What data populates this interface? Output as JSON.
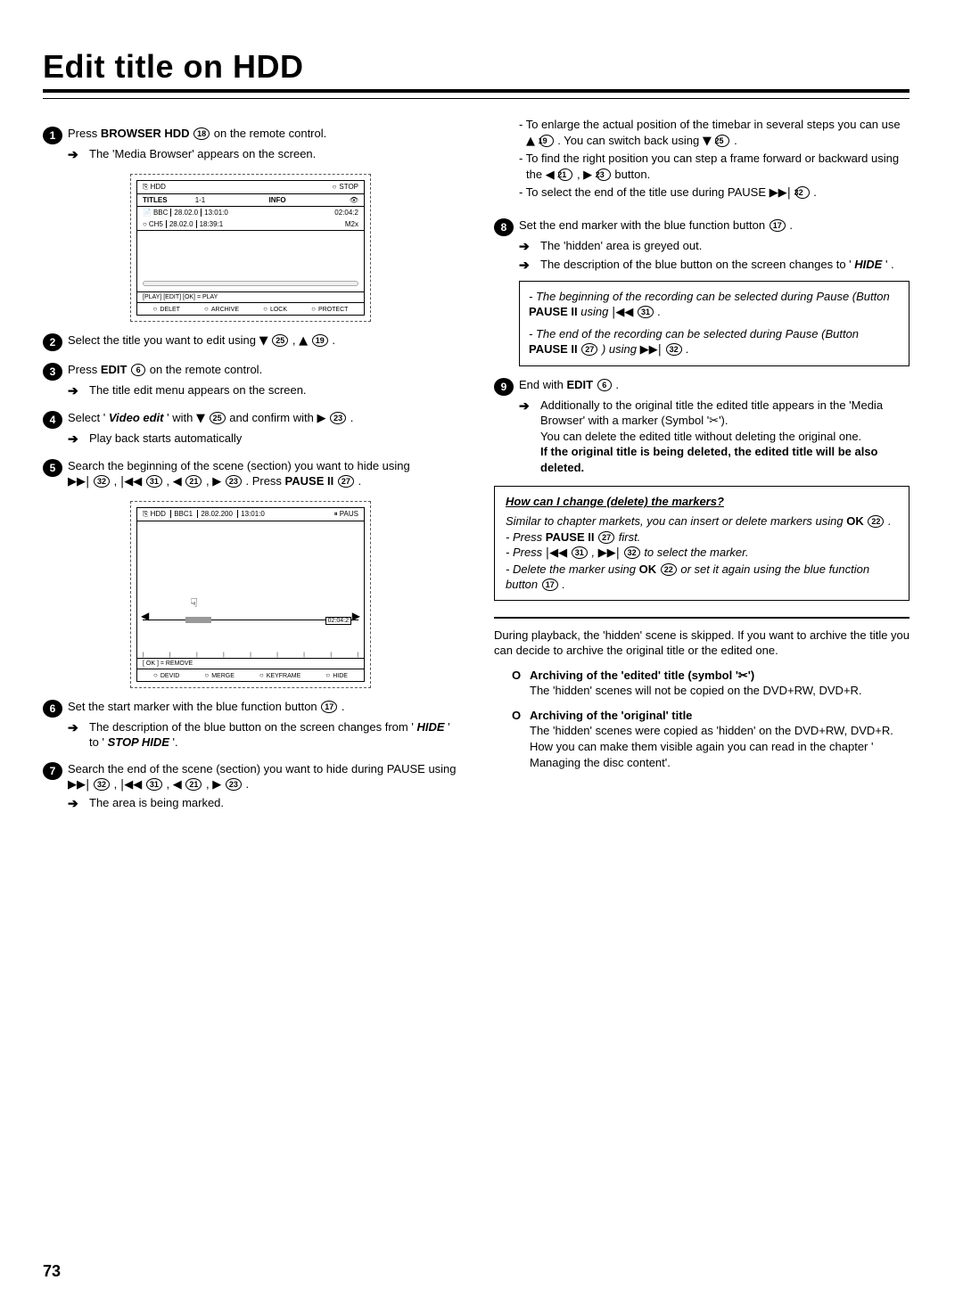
{
  "page_number": "73",
  "heading": "Edit title on HDD",
  "left": {
    "s1": {
      "pre": "Press ",
      "btn": "BROWSER HDD",
      "ref": "18",
      "post": " on the remote control."
    },
    "s1a": "The 'Media Browser' appears on the screen.",
    "screen1": {
      "topLeft": "HDD",
      "topRight": "STOP",
      "h_titles": "TITLES",
      "h_idx": "1-1",
      "h_info": "INFO",
      "h_eye": "👁",
      "r1": [
        "BBC",
        "28.02.0",
        "13:01:0"
      ],
      "r1r": "02:04:2",
      "r2": [
        "CH5",
        "28.02.0",
        "18:39:1"
      ],
      "r2r": "M2x",
      "foot": "[PLAY] [EDIT] [OK] = PLAY",
      "b1": "DELET",
      "b2": "ARCHIVE",
      "b3": "LOCK",
      "b4": "PROTECT"
    },
    "s2": {
      "pre": "Select the title you want to edit using ",
      "g1": "▼",
      "r1": "25",
      "mid": " , ",
      "g2": "▲",
      "r2": "19",
      "post": " ."
    },
    "s3": {
      "pre": "Press ",
      "btn": "EDIT",
      "ref": "6",
      "post": " on the remote control."
    },
    "s3a": "The title edit menu appears on the screen.",
    "s4": {
      "pre": "Select '",
      "em": "Video edit",
      "mid": "' with ",
      "g1": "▼",
      "r1": "25",
      "mid2": " and confirm with ",
      "g2": "▶",
      "r2": "23",
      "post": " ."
    },
    "s4a": "Play back starts automatically",
    "s5": {
      "line": "Search the beginning of the scene (section) you want to hide using",
      "ctrl": [
        [
          "▶▶|",
          "32"
        ],
        [
          "|◀◀",
          "31"
        ],
        [
          "◀",
          "21"
        ],
        [
          "▶",
          "23"
        ]
      ],
      "post": ". Press ",
      "btn": "PAUSE II",
      "r": "27",
      "end": " ."
    },
    "screen2": {
      "top": [
        "HDD",
        "BBC1",
        "28.02.200",
        "13:01:0"
      ],
      "topRight": "PAUS",
      "ok": "[ OK ] = REMOVE",
      "time": "02:04:2",
      "b1": "DEVID",
      "b2": "MERGE",
      "b3": "KEYFRAME",
      "b4": "HIDE"
    },
    "s6": {
      "pre": "Set the start marker with the blue function button ",
      "ref": "17",
      "post": " ."
    },
    "s6a_pre": "The description of the blue button on the screen changes from '",
    "s6a_em": "HIDE",
    "s6a_mid": "' to '",
    "s6a_em2": "STOP HIDE",
    "s6a_post": "'.",
    "s7": {
      "line": "Search the end of the scene (section) you want to hide during PAUSE using ",
      "ctrl": [
        [
          "▶▶|",
          "32"
        ],
        [
          "|◀◀",
          "31"
        ],
        [
          "◀",
          "21"
        ],
        [
          "▶",
          "23"
        ]
      ]
    },
    "s7a": "The area is being marked."
  },
  "right": {
    "n1": {
      "pre": "To enlarge the actual position of the timebar in several steps you can use ",
      "g1": "▲",
      "r1": "19",
      "mid": " . You can switch back using ",
      "g2": "▼",
      "r2": "25",
      "post": " ."
    },
    "n2": {
      "pre": "To find the right position you can step a frame forward or backward using the ",
      "g1": "◀",
      "r1": "21",
      "mid": " , ",
      "g2": "▶",
      "r2": "23",
      "post": " button."
    },
    "n3": {
      "pre": "To select the end of the title use during PAUSE ",
      "g": "▶▶|",
      "r": "32",
      "post": " ."
    },
    "s8": {
      "pre": "Set the end marker with the blue function button",
      "ref": "17",
      "post": " ."
    },
    "s8a": "The 'hidden' area is greyed out.",
    "s8b_pre": "The description of the blue button on the screen changes to '",
    "s8b_em": "HIDE",
    "s8b_post": "' .",
    "box1": {
      "l1_pre": "The beginning of the recording can be selected during Pause (Button ",
      "l1_btn": "PAUSE II",
      "l1_mid": " using ",
      "l1_g": "|◀◀",
      "l1_r": "31",
      "l1_post": " .",
      "l2_pre": "The end of the recording can be selected during Pause (Button ",
      "l2_btn": "PAUSE II",
      "l2_r0": "27",
      "l2_mid": " ) using ",
      "l2_g": "▶▶|",
      "l2_r": "32",
      "l2_post": " ."
    },
    "s9": {
      "pre": "End with ",
      "btn": "EDIT",
      "ref": "6",
      "post": " ."
    },
    "s9a": "Additionally to the original title the edited title appears in the 'Media Browser' with a marker (Symbol '✂').",
    "s9b": "You can delete the edited title without deleting the original one.",
    "s9c": "If the original title is being deleted, the edited title will be also deleted.",
    "box2": {
      "hdr": "How can I change (delete) the markers?",
      "l1": "Similar to chapter markets, you can insert or delete markers using ",
      "l1_btn": "OK",
      "l1_r": "22",
      "l1_post": " .",
      "l2": "Press ",
      "l2_btn": "PAUSE II",
      "l2_r": "27",
      "l2_post": " first.",
      "l3": "Press ",
      "l3_g1": "|◀◀",
      "l3_r1": "31",
      "l3_mid": " , ",
      "l3_g2": "▶▶|",
      "l3_r2": "32",
      "l3_post": " to select the marker.",
      "l4": "Delete the marker using ",
      "l4_btn": "OK",
      "l4_r": "22",
      "l4_mid": " or set it again using the blue function button",
      "l4_r2": "17",
      "l4_post": " ."
    },
    "para": "During playback, the 'hidden' scene is skipped. If you want to archive the title you can decide to archive the original title or the edited one.",
    "bub1_h": "Archiving of the 'edited' title (symbol '✂')",
    "bub1_b": "The 'hidden' scenes will not be copied on the DVD+RW, DVD+R.",
    "bub2_h": "Archiving of the 'original' title",
    "bub2_b": "The 'hidden' scenes were copied as 'hidden' on the DVD+RW, DVD+R. How you can make them visible again you can read in the chapter ' Managing the disc content'."
  }
}
